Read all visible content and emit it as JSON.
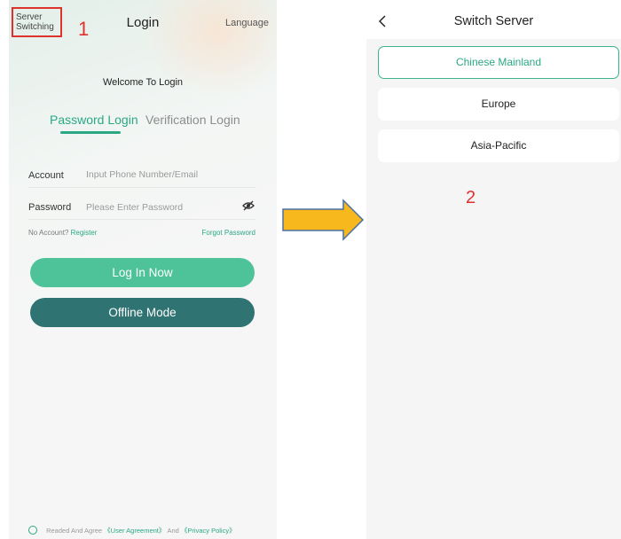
{
  "login": {
    "server_switch_label": "Server Switching",
    "title": "Login",
    "language_label": "Language",
    "welcome": "Welcome To Login",
    "tabs": [
      "Password Login",
      "Verification Login"
    ],
    "active_tab": "Password Login",
    "account_label": "Account",
    "account_placeholder": "Input Phone Number/Email",
    "password_label": "Password",
    "password_placeholder": "Please Enter Password",
    "no_account_text": "No Account?",
    "register_label": "Register",
    "forgot_label": "Forgot Password",
    "login_button": "Log In Now",
    "offline_button": "Offline Mode",
    "agree_text": "Readed And Agree",
    "user_agreement": "《User Agreement》",
    "and_text": "And",
    "privacy_policy": "《Privacy Policy》"
  },
  "annotations": {
    "step1": "1",
    "step2": "2"
  },
  "server": {
    "title": "Switch Server",
    "options": [
      "Chinese Mainland",
      "Europe",
      "Asia-Pacific"
    ],
    "selected": "Chinese Mainland"
  },
  "icons": {
    "eye": "eye-hidden-icon",
    "back": "chevron-left-icon",
    "arrow": "right-arrow"
  },
  "colors": {
    "accent": "#2aa884",
    "login_button": "#4ec39a",
    "offline_button": "#2f7373",
    "annotation": "#e0322d",
    "arrow_fill": "#f6b81c",
    "arrow_stroke": "#4a6fa5"
  }
}
